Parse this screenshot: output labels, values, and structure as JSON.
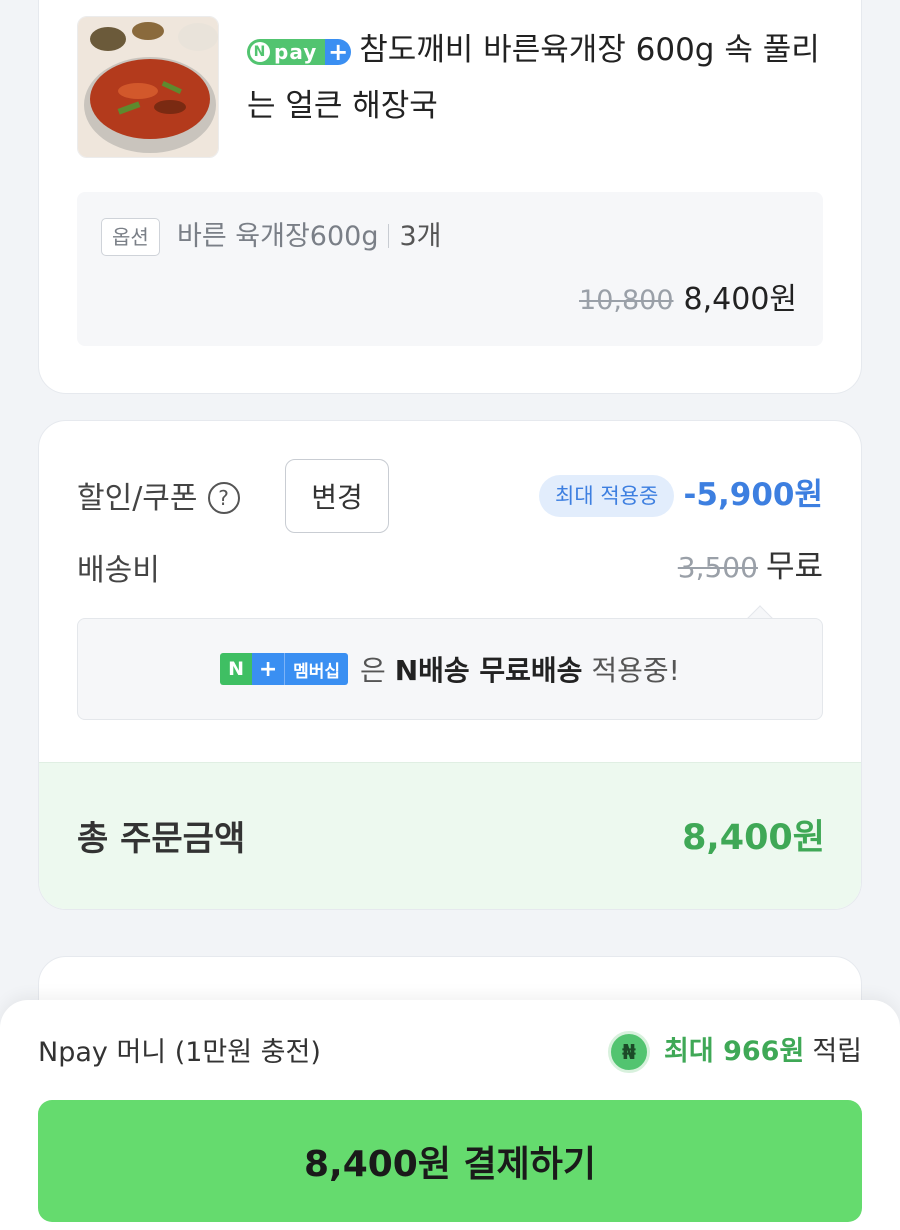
{
  "product": {
    "npay_label": "pay",
    "name": "참도깨비 바른육개장 600g 속 풀리는 얼큰 해장국",
    "option_tag": "옵션",
    "option_name": "바른 육개장600g",
    "option_qty": "3개",
    "original_price": "10,800",
    "price": "8,400원"
  },
  "summary": {
    "discount_label": "할인/쿠폰",
    "change_button": "변경",
    "max_badge": "최대 적용중",
    "discount_amount": "-5,900원",
    "shipping_label": "배송비",
    "shipping_original": "3,500",
    "shipping_value": "무료",
    "membership_badge": "멤버십",
    "membership_text_1": "은",
    "membership_text_bold": "N배송 무료배송",
    "membership_text_2": "적용중!",
    "total_label": "총 주문금액",
    "total_amount": "8,400원"
  },
  "bottom": {
    "payment_method": "Npay 머니 (1만원 충전)",
    "reward_prefix": "최대",
    "reward_amount": "966원",
    "reward_suffix": "적립",
    "pay_button": "8,400원 결제하기"
  },
  "colors": {
    "accent_green": "#65db6e",
    "total_green": "#3fa856",
    "discount_blue": "#3d7fe0"
  }
}
